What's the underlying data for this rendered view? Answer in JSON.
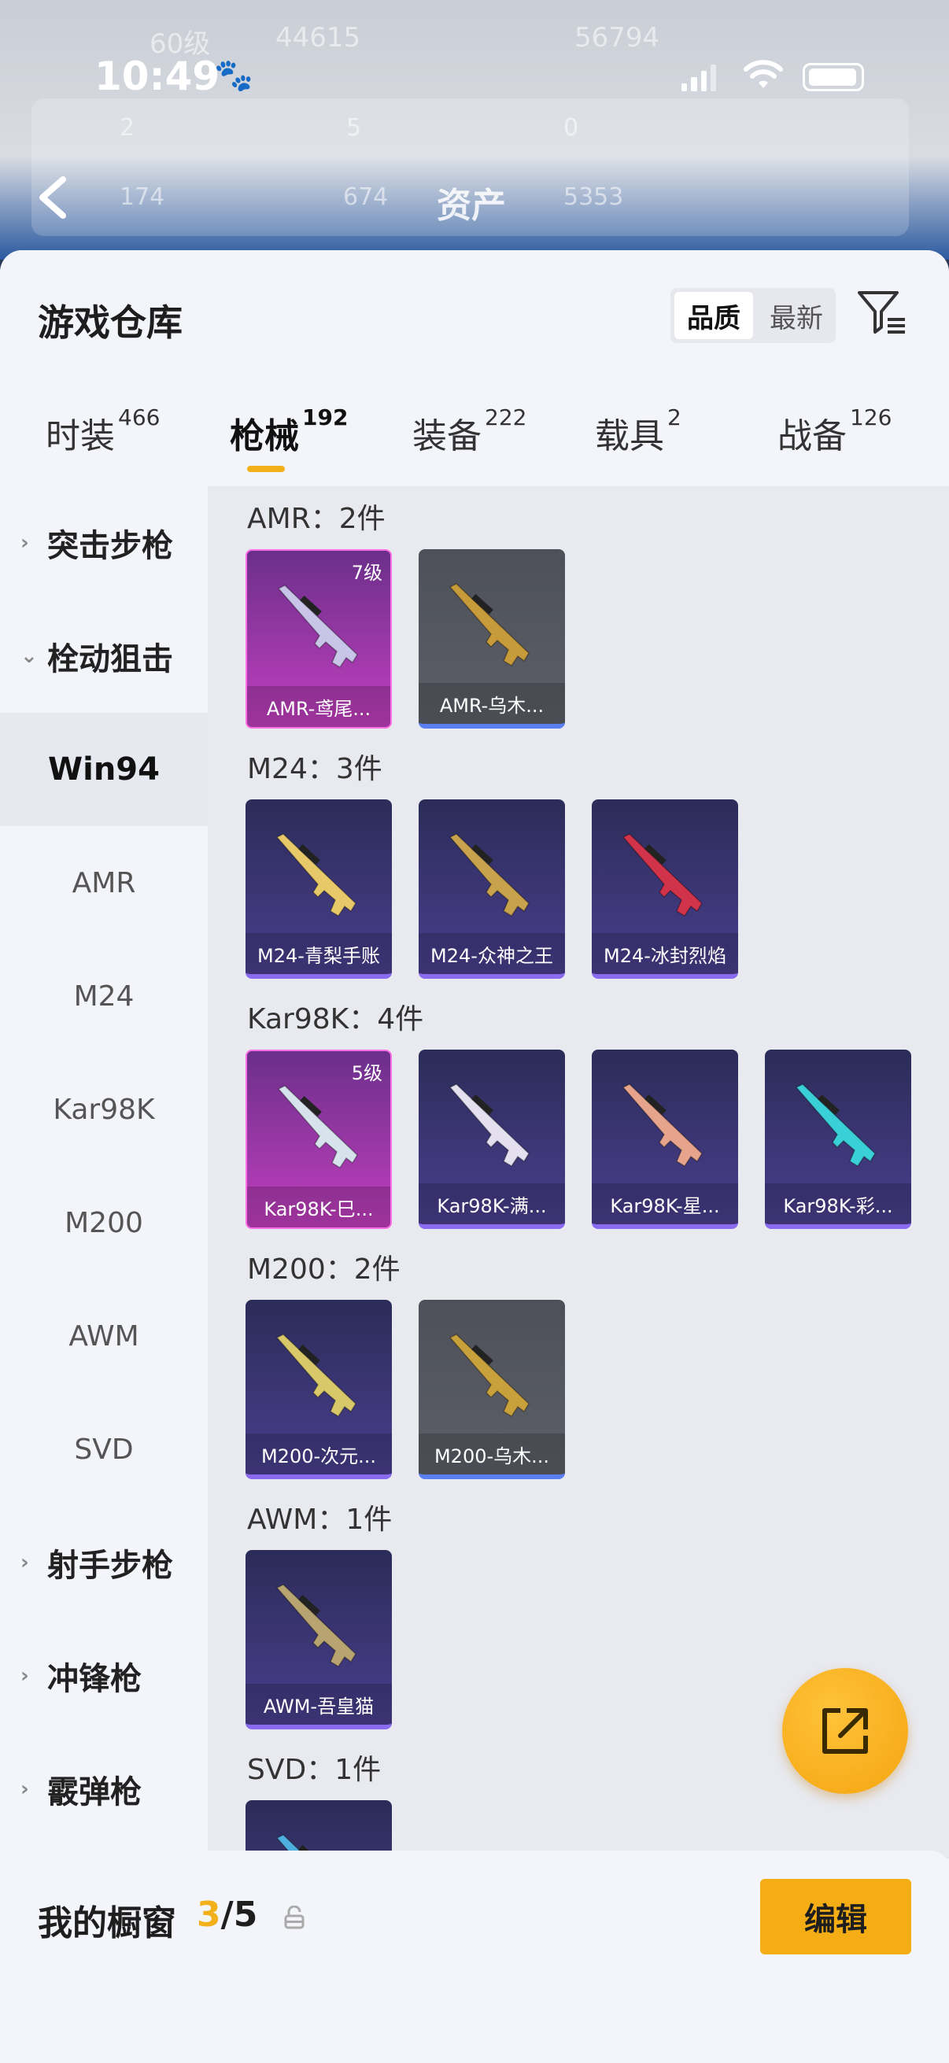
{
  "status_bar": {
    "time": "10:49"
  },
  "background": {
    "level_text": "60级",
    "views": "44615",
    "score": "56794",
    "title": "资产",
    "stat_a": "2",
    "stat_b": "5",
    "stat_c": "0",
    "stat_d": "174",
    "stat_e": "674",
    "stat_f": "5353"
  },
  "sheet": {
    "title": "游戏仓库",
    "sort": {
      "options": [
        "品质",
        "最新"
      ],
      "active": "品质"
    }
  },
  "tabs": [
    {
      "label": "时装",
      "count": "466"
    },
    {
      "label": "枪械",
      "count": "192",
      "active": true
    },
    {
      "label": "装备",
      "count": "222"
    },
    {
      "label": "载具",
      "count": "2"
    },
    {
      "label": "战备",
      "count": "126"
    }
  ],
  "sidebar": {
    "items": [
      {
        "label": "突击步枪",
        "type": "category",
        "expanded": false
      },
      {
        "label": "栓动狙击",
        "type": "category",
        "expanded": true
      },
      {
        "label": "Win94",
        "type": "sub",
        "selected": true
      },
      {
        "label": "AMR",
        "type": "sub"
      },
      {
        "label": "M24",
        "type": "sub"
      },
      {
        "label": "Kar98K",
        "type": "sub"
      },
      {
        "label": "M200",
        "type": "sub"
      },
      {
        "label": "AWM",
        "type": "sub"
      },
      {
        "label": "SVD",
        "type": "sub"
      },
      {
        "label": "射手步枪",
        "type": "category",
        "expanded": false
      },
      {
        "label": "冲锋枪",
        "type": "category",
        "expanded": false
      },
      {
        "label": "霰弹枪",
        "type": "category",
        "expanded": false
      }
    ]
  },
  "groups": [
    {
      "title": "AMR：2件",
      "items": [
        {
          "name": "AMR-鸢尾...",
          "rarity": "purple",
          "level": "7级",
          "gun_color": "#c9c5e8"
        },
        {
          "name": "AMR-乌木...",
          "rarity": "gray",
          "gun_color": "#c79a3a"
        }
      ]
    },
    {
      "title": "M24：3件",
      "items": [
        {
          "name": "M24-青梨手账",
          "rarity": "blue",
          "gun_color": "#e7c969"
        },
        {
          "name": "M24-众神之王",
          "rarity": "blue",
          "gun_color": "#c8a24c"
        },
        {
          "name": "M24-冰封烈焰",
          "rarity": "blue",
          "gun_color": "#d0334a"
        }
      ]
    },
    {
      "title": "Kar98K：4件",
      "items": [
        {
          "name": "Kar98K-巳...",
          "rarity": "purple",
          "level": "5级",
          "gun_color": "#d6e2ec"
        },
        {
          "name": "Kar98K-满...",
          "rarity": "blue",
          "gun_color": "#e4e0f0"
        },
        {
          "name": "Kar98K-星...",
          "rarity": "blue",
          "gun_color": "#e6a48c"
        },
        {
          "name": "Kar98K-彩...",
          "rarity": "blue",
          "gun_color": "#3ad0d8"
        }
      ]
    },
    {
      "title": "M200：2件",
      "items": [
        {
          "name": "M200-次元...",
          "rarity": "blue",
          "gun_color": "#d8c86a"
        },
        {
          "name": "M200-乌木...",
          "rarity": "gray",
          "gun_color": "#c9a13c"
        }
      ]
    },
    {
      "title": "AWM：1件",
      "items": [
        {
          "name": "AWM-吾皇猫",
          "rarity": "blue",
          "gun_color": "#b8a470"
        }
      ]
    },
    {
      "title": "SVD：1件",
      "items": [
        {
          "name": "",
          "rarity": "blue",
          "gun_color": "#4fb0e0"
        }
      ]
    }
  ],
  "showcase": {
    "label": "我的橱窗",
    "current": "3",
    "total": "/5",
    "edit_label": "编辑"
  },
  "colors": {
    "accent": "#f2b11b",
    "purple_rarity": "#c23fbf",
    "blue_rarity": "#4a3e8e"
  },
  "icons": {
    "filter": "filter-icon",
    "share": "share-icon",
    "lock": "lock-icon",
    "back": "back-arrow-icon"
  }
}
